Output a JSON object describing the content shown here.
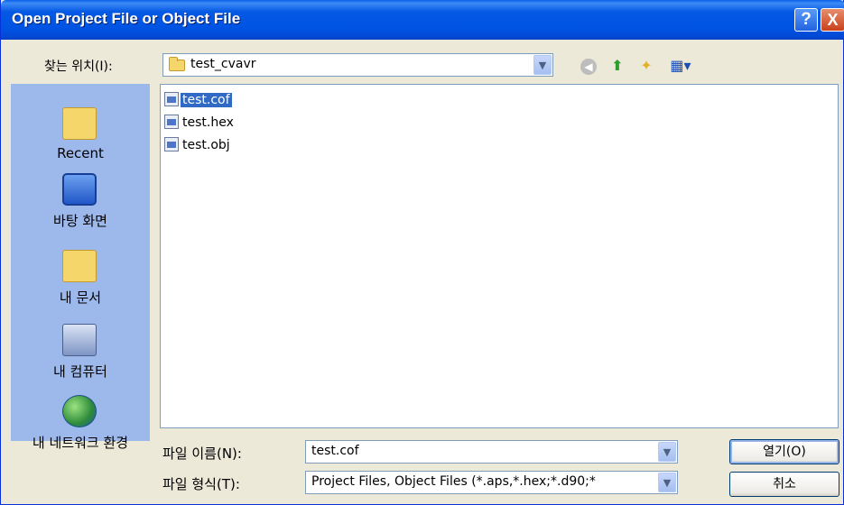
{
  "window": {
    "title": "Open Project File or Object File",
    "help_glyph": "?",
    "close_glyph": "X"
  },
  "lookin": {
    "label": "찾는 위치(I):",
    "value": "test_cvavr",
    "dropdown_glyph": "▼"
  },
  "nav": {
    "back_glyph": "◀",
    "up_glyph": "⬆",
    "newfolder_glyph": "✦",
    "views_glyph": "▦▾"
  },
  "places": [
    {
      "label": "Recent",
      "icon": "folder-icon"
    },
    {
      "label": "바탕 화면",
      "icon": "desktop-icon"
    },
    {
      "label": "내 문서",
      "icon": "my-documents-icon"
    },
    {
      "label": "내 컴퓨터",
      "icon": "my-computer-icon"
    },
    {
      "label": "내 네트워크 환경",
      "icon": "network-icon"
    }
  ],
  "files": [
    {
      "name": "test.cof",
      "selected": true
    },
    {
      "name": "test.hex",
      "selected": false
    },
    {
      "name": "test.obj",
      "selected": false
    }
  ],
  "filename": {
    "label": "파일 이름(N):",
    "value": "test.cof"
  },
  "filetype": {
    "label": "파일 형식(T):",
    "value": "Project Files, Object Files (*.aps,*.hex;*.d90;*"
  },
  "buttons": {
    "open": "열기(O)",
    "cancel": "취소"
  }
}
